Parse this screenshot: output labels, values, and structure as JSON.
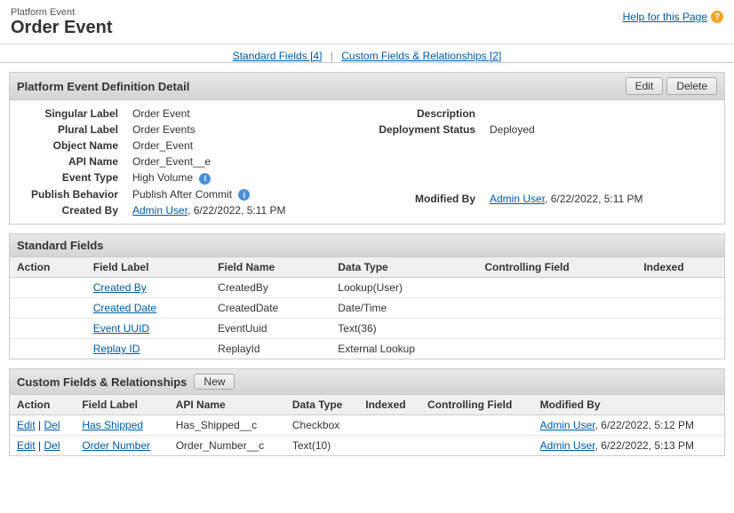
{
  "header": {
    "page_type": "Platform Event",
    "page_title": "Order Event",
    "help_link_label": "Help for this Page"
  },
  "nav": {
    "tabs": [
      {
        "label": "Standard Fields",
        "count": "[4]"
      },
      {
        "label": "Custom Fields & Relationships",
        "count": "[2]"
      }
    ],
    "separator": "|"
  },
  "detail_section": {
    "title": "Platform Event Definition Detail",
    "edit_button": "Edit",
    "delete_button": "Delete",
    "fields": {
      "singular_label_lbl": "Singular Label",
      "singular_label_val": "Order Event",
      "plural_label_lbl": "Plural Label",
      "plural_label_val": "Order Events",
      "object_name_lbl": "Object Name",
      "object_name_val": "Order_Event",
      "api_name_lbl": "API Name",
      "api_name_val": "Order_Event__e",
      "event_type_lbl": "Event Type",
      "event_type_val": "High Volume",
      "publish_behavior_lbl": "Publish Behavior",
      "publish_behavior_val": "Publish After Commit",
      "created_by_lbl": "Created By",
      "created_by_val": "Admin User, 6/22/2022, 5:11 PM",
      "description_lbl": "Description",
      "description_val": "",
      "deployment_status_lbl": "Deployment Status",
      "deployment_status_val": "Deployed",
      "modified_by_lbl": "Modified By",
      "modified_by_val": "Admin User, 6/22/2022, 5:11 PM"
    }
  },
  "standard_fields": {
    "title": "Standard Fields",
    "columns": [
      "Action",
      "Field Label",
      "Field Name",
      "Data Type",
      "Controlling Field",
      "Indexed"
    ],
    "rows": [
      {
        "action": "",
        "field_label": "Created By",
        "field_name": "CreatedBy",
        "data_type": "Lookup(User)",
        "controlling_field": "",
        "indexed": ""
      },
      {
        "action": "",
        "field_label": "Created Date",
        "field_name": "CreatedDate",
        "data_type": "Date/Time",
        "controlling_field": "",
        "indexed": ""
      },
      {
        "action": "",
        "field_label": "Event UUID",
        "field_name": "EventUuid",
        "data_type": "Text(36)",
        "controlling_field": "",
        "indexed": ""
      },
      {
        "action": "",
        "field_label": "Replay ID",
        "field_name": "ReplayId",
        "data_type": "External Lookup",
        "controlling_field": "",
        "indexed": ""
      }
    ]
  },
  "custom_fields": {
    "title": "Custom Fields & Relationships",
    "new_button": "New",
    "columns": [
      "Action",
      "Field Label",
      "API Name",
      "Data Type",
      "Indexed",
      "Controlling Field",
      "Modified By"
    ],
    "rows": [
      {
        "edit": "Edit",
        "del": "Del",
        "field_label": "Has Shipped",
        "api_name": "Has_Shipped__c",
        "data_type": "Checkbox",
        "indexed": "",
        "controlling_field": "",
        "modified_by": "Admin User, 6/22/2022, 5:12 PM"
      },
      {
        "edit": "Edit",
        "del": "Del",
        "field_label": "Order Number",
        "api_name": "Order_Number__c",
        "data_type": "Text(10)",
        "indexed": "",
        "controlling_field": "",
        "modified_by": "Admin User, 6/22/2022, 5:13 PM"
      }
    ]
  }
}
